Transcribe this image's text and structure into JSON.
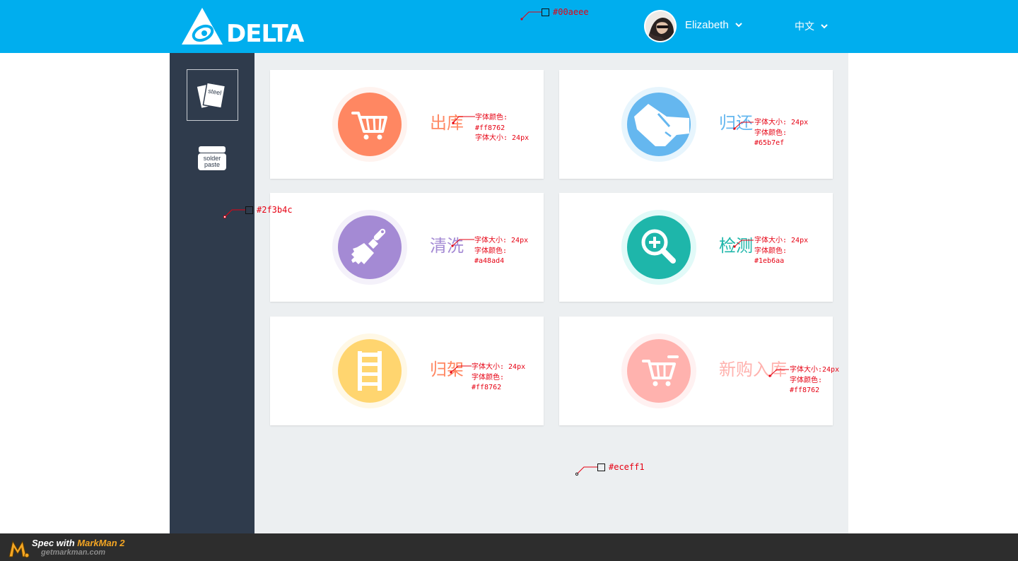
{
  "header": {
    "brand": "DELTA",
    "user_name": "Elizabeth",
    "language": "中文",
    "background": "#00aeee"
  },
  "sidebar": {
    "background": "#2f3b4c",
    "items": [
      {
        "label": "steel",
        "icon": "steel-sheets-icon",
        "active": true
      },
      {
        "label_line1": "solder",
        "label_line2": "paste",
        "icon": "solder-paste-jar-icon",
        "active": false
      }
    ]
  },
  "main": {
    "background": "#eceff1",
    "cards": [
      {
        "label": "出库",
        "color": "#ff8762",
        "icon": "cart-icon"
      },
      {
        "label": "归还",
        "color": "#65b7ef",
        "icon": "handshake-icon"
      },
      {
        "label": "清洗",
        "color": "#a48ad4",
        "icon": "brush-icon"
      },
      {
        "label": "检测",
        "color": "#1eb6aa",
        "icon": "magnifier-plus-icon"
      },
      {
        "label": "归架",
        "color": "#ff8762",
        "icon": "shelf-ladder-icon"
      },
      {
        "label": "新购入库",
        "color": "#ff8762",
        "icon": "cart-icon"
      }
    ]
  },
  "annotations": {
    "header_color": "#00aeee",
    "sidebar_color": "#2f3b4c",
    "main_color": "#eceff1",
    "card1": [
      "字体颜色:",
      "#ff8762",
      "字体大小: 24px"
    ],
    "card2": [
      "字体大小: 24px",
      "字体颜色:",
      "#65b7ef"
    ],
    "card3": [
      "字体大小: 24px",
      "字体颜色:",
      "#a48ad4"
    ],
    "card4": [
      "字体大小: 24px",
      "字体颜色:",
      "#1eb6aa"
    ],
    "card5": [
      "字体大小: 24px",
      "字体颜色:",
      "#ff8762"
    ],
    "card6": [
      "字体大小:24px",
      "字体颜色:",
      "#ff8762"
    ]
  },
  "footer": {
    "spec_prefix": "Spec with ",
    "brand": "MarkMan 2",
    "url": "getmarkman.com"
  }
}
